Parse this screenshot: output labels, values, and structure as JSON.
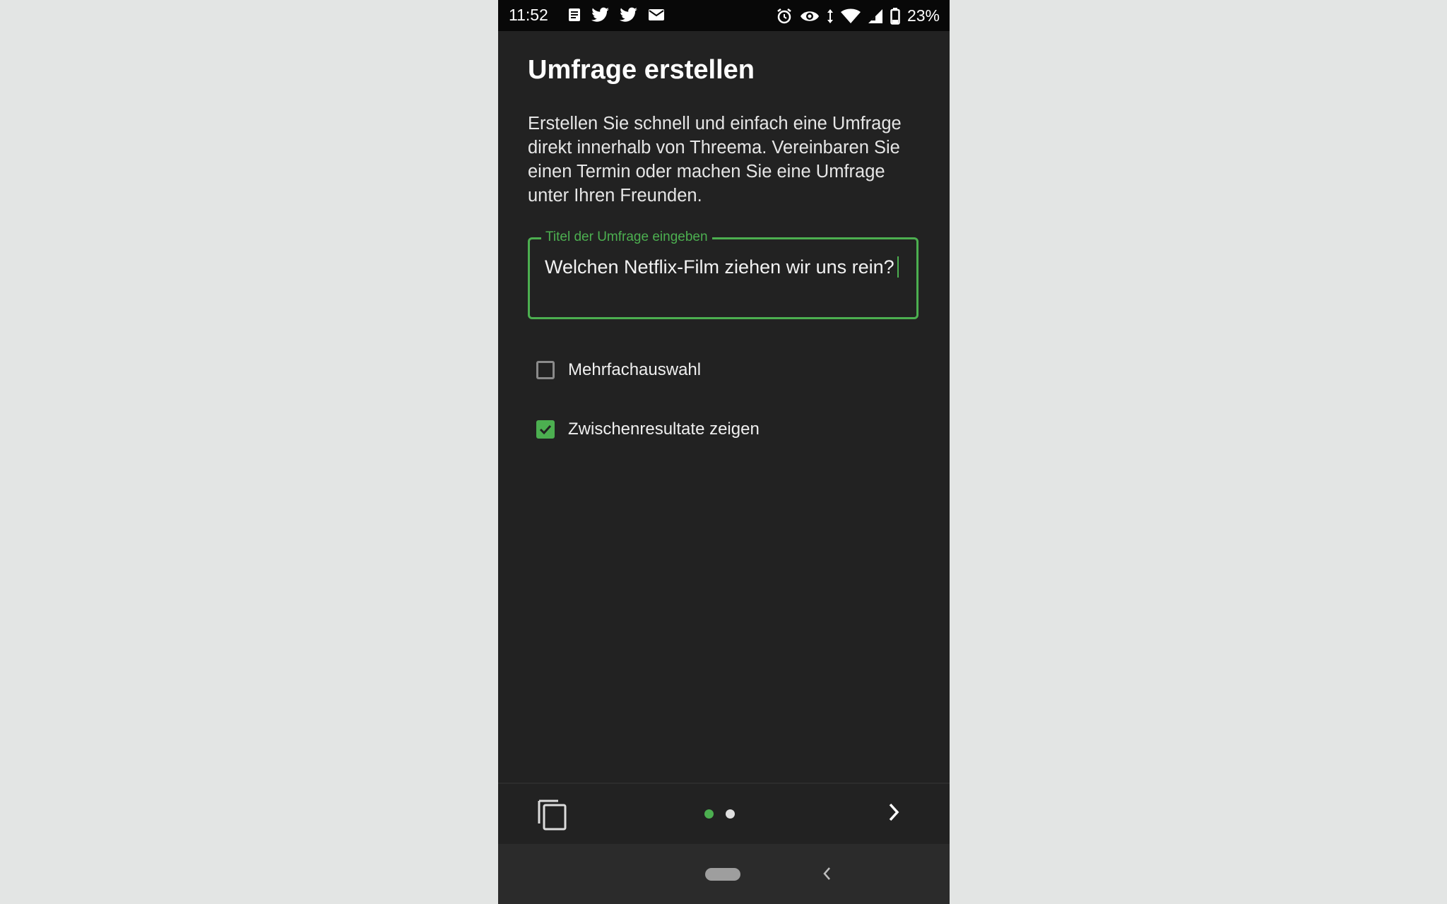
{
  "status_bar": {
    "time": "11:52",
    "battery": "23%",
    "left_icons": [
      "notes-icon",
      "twitter-icon",
      "twitter-icon",
      "mail-icon"
    ],
    "right_icons": [
      "alarm-icon",
      "eye-icon",
      "data-arrows-icon",
      "wifi-icon",
      "signal-icon",
      "battery-icon"
    ]
  },
  "page": {
    "title": "Umfrage erstellen",
    "description": "Erstellen Sie schnell und einfach eine Umfrage direkt innerhalb von Threema. Vereinbaren Sie einen Termin oder machen Sie eine Umfrage unter Ihren Freunden."
  },
  "title_field": {
    "label": "Titel der Umfrage eingeben",
    "value": "Welchen Netflix-Film ziehen wir uns rein?"
  },
  "options": [
    {
      "label": "Mehrfachauswahl",
      "checked": false
    },
    {
      "label": "Zwischenresultate zeigen",
      "checked": true
    }
  ],
  "pager": {
    "pages": 2,
    "current": 1
  },
  "colors": {
    "accent": "#4caf50",
    "background": "#222222",
    "outer_background": "#e3e5e4",
    "status_bar": "#080808",
    "inactive_dot": "#e0e0e0"
  }
}
